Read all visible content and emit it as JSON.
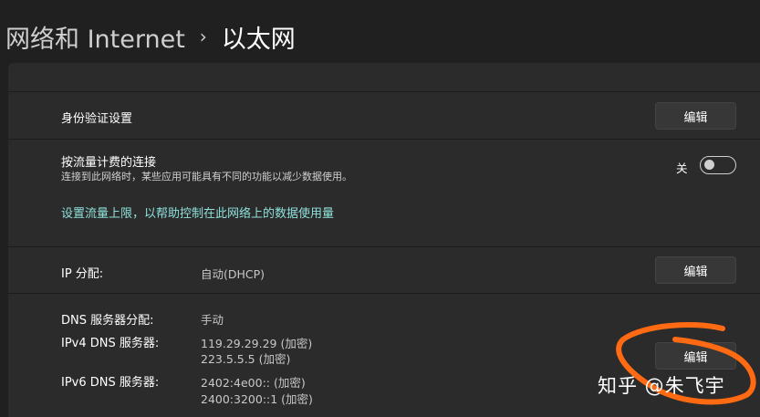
{
  "header": {
    "parent": "网络和 Internet",
    "separator": "›",
    "title": "以太网"
  },
  "auth": {
    "label": "身份验证设置",
    "edit_label": "编辑"
  },
  "metered": {
    "label": "按流量计费的连接",
    "description": "连接到此网络时，某些应用可能具有不同的功能以减少数据使用。",
    "toggle_state_label": "关",
    "toggle_on": false,
    "link": "设置流量上限，以帮助控制在此网络上的数据使用量"
  },
  "ip": {
    "label": "IP 分配:",
    "value": "自动(DHCP)",
    "edit_label": "编辑"
  },
  "dns": {
    "assign_label": "DNS 服务器分配:",
    "assign_value": "手动",
    "ipv4_label": "IPv4 DNS 服务器:",
    "ipv4_primary": "119.29.29.29 (加密)",
    "ipv4_secondary": "223.5.5.5 (加密)",
    "ipv6_label": "IPv6 DNS 服务器:",
    "ipv6_primary": "2402:4e00:: (加密)",
    "ipv6_secondary": "2400:3200::1 (加密)",
    "edit_label": "编辑"
  },
  "watermark": "知乎 @朱飞宇",
  "colors": {
    "background": "#202020",
    "panel": "#2b2b2b",
    "link": "#8ee0da",
    "annotation": "#ff6a13"
  }
}
